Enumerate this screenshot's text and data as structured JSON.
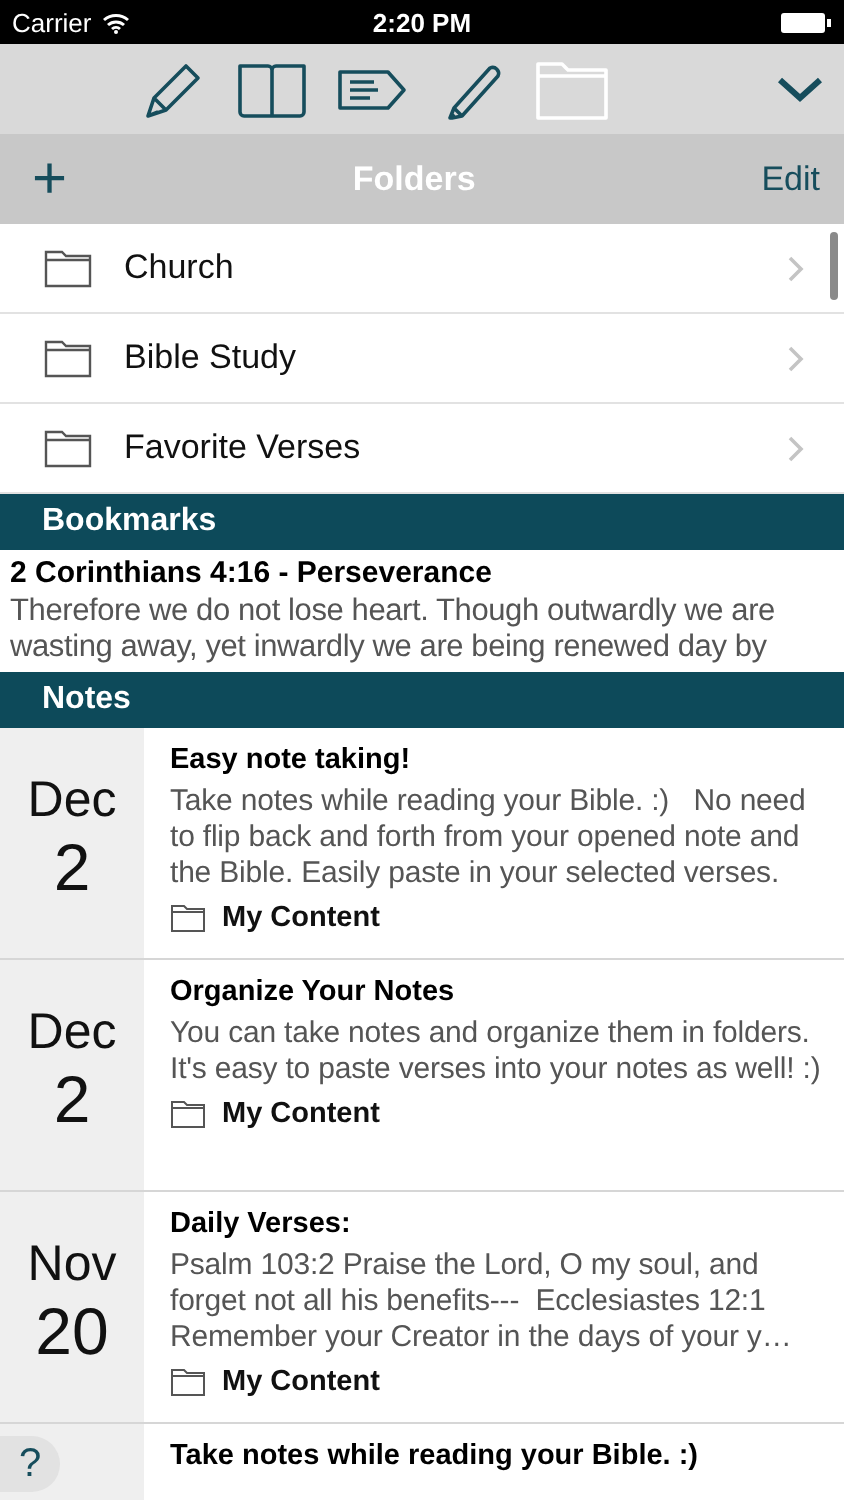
{
  "status_bar": {
    "carrier": "Carrier",
    "time": "2:20 PM"
  },
  "toolbar": [
    {
      "kind": "pencil",
      "selected": false
    },
    {
      "kind": "book",
      "selected": false
    },
    {
      "kind": "tag",
      "selected": false
    },
    {
      "kind": "highlighter",
      "selected": false
    },
    {
      "kind": "folder",
      "selected": true
    }
  ],
  "nav_bar": {
    "add": "+",
    "title": "Folders",
    "edit": "Edit"
  },
  "folders": [
    {
      "name": "Church"
    },
    {
      "name": "Bible Study"
    },
    {
      "name": "Favorite Verses"
    }
  ],
  "bookmarks": {
    "header": "Bookmarks",
    "items": [
      {
        "title": "2 Corinthians 4:16 - Perseverance",
        "text": "Therefore we do not lose heart. Though outwardly we are wasting away, yet inwardly we are being renewed day by"
      }
    ]
  },
  "notes": {
    "header": "Notes",
    "items": [
      {
        "month": "Dec",
        "day": "2",
        "title": "Easy note taking!",
        "text": "Take notes while reading your Bible. :)   No need to flip back and forth from your opened note and the Bible. Easily paste in your selected verses.",
        "folder": "My Content"
      },
      {
        "month": "Dec",
        "day": "2",
        "title": "Organize Your Notes",
        "text": "You can take notes and organize them in folders. It's easy to paste verses into your notes as well! :)",
        "folder": "My Content"
      },
      {
        "month": "Nov",
        "day": "20",
        "title": "Daily Verses:",
        "text": "Psalm 103:2 Praise the Lord, O my soul, and forget not all his benefits---  Ecclesiastes 12:1 Remember your Creator in the days of your y…",
        "folder": "My Content"
      },
      {
        "title": "Take notes while reading your Bible. :)"
      }
    ]
  },
  "help_button": "?"
}
